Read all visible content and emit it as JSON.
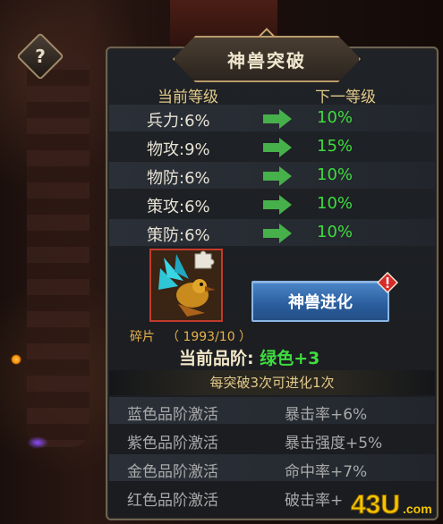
{
  "help": {
    "icon": "question-icon",
    "glyph": "?"
  },
  "title": "神兽突破",
  "columns": {
    "current": "当前等级",
    "next": "下一等级"
  },
  "stats": [
    {
      "current": "兵力:6%",
      "next": "10%"
    },
    {
      "current": "物攻:9%",
      "next": "15%"
    },
    {
      "current": "物防:6%",
      "next": "10%"
    },
    {
      "current": "策攻:6%",
      "next": "10%"
    },
    {
      "current": "策防:6%",
      "next": "10%"
    }
  ],
  "fragment": {
    "label": "碎片",
    "count": "（ 1993/10 ）"
  },
  "evolve_button": "神兽进化",
  "grade": {
    "label": "当前品阶:",
    "value": "绿色+3"
  },
  "note": "每突破3次可进化1次",
  "activations": [
    {
      "name": "蓝色品阶激活",
      "bonus": "暴击率+6%"
    },
    {
      "name": "紫色品阶激活",
      "bonus": "暴击强度+5%"
    },
    {
      "name": "金色品阶激活",
      "bonus": "命中率+7%"
    },
    {
      "name": "红色品阶激活",
      "bonus": "破击率+"
    }
  ],
  "watermark": "43U.com",
  "colors": {
    "green": "#3fdc3f",
    "gold": "#e2c98a",
    "button_blue": "#2a5d9c",
    "alert_red": "#d62b2b"
  }
}
